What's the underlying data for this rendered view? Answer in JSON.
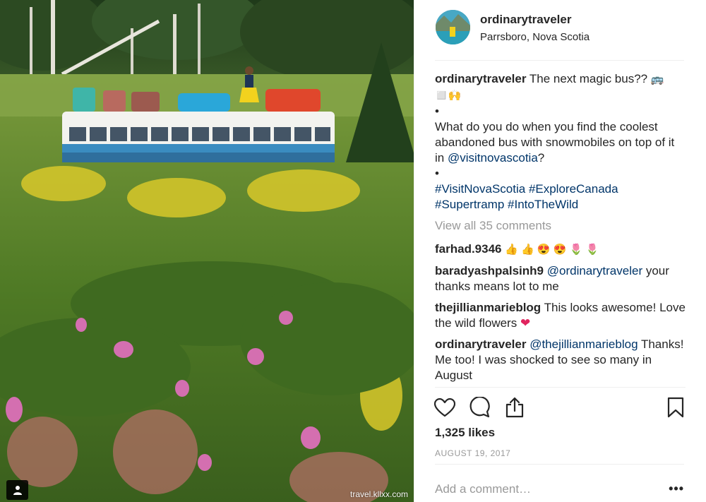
{
  "post": {
    "username": "ordinarytraveler",
    "location": "Parrsboro, Nova Scotia",
    "caption": {
      "username": "ordinarytraveler",
      "line1": " The next magic bus?? ",
      "line1_emoji": "🚌",
      "line1_emoji2": "◻️🙌",
      "bullet": "•",
      "body_a": "What do you do when you find the coolest abandoned bus with snowmobiles on top of it in ",
      "mention": "@visitnovascotia",
      "body_b": "?",
      "tags": [
        "#VisitNovaScotia",
        "#ExploreCanada",
        "#Supertramp",
        "#IntoTheWild"
      ]
    },
    "view_all": "View all 35 comments",
    "comments": [
      {
        "user": "farhad.9346",
        "emoji": "👍 👍 😍 😍 🌷 🌷"
      },
      {
        "user": "baradyashpalsinh9",
        "mention": "@ordinarytraveler",
        "text": " your thanks means lot to me"
      },
      {
        "user": "thejillianmarieblog",
        "text": " This looks awesome! Love the wild flowers ",
        "emoji": "❤"
      },
      {
        "user": "ordinarytraveler",
        "mention": "@thejillianmarieblog",
        "text": " Thanks! Me too! I was shocked to see so many in August"
      }
    ],
    "likes": "1,325 likes",
    "date": "AUGUST 19, 2017",
    "add_comment_placeholder": "Add a comment…",
    "more_label": "•••"
  },
  "watermark": "travel.kllxx.com",
  "icons": {
    "like": "heart-icon",
    "comment": "comment-icon",
    "share": "share-icon",
    "save": "bookmark-icon",
    "user_tag": "user-tag-icon"
  },
  "colors": {
    "link": "#003569",
    "muted": "#999999",
    "divider": "#efefef",
    "heart": "#e0245e"
  }
}
